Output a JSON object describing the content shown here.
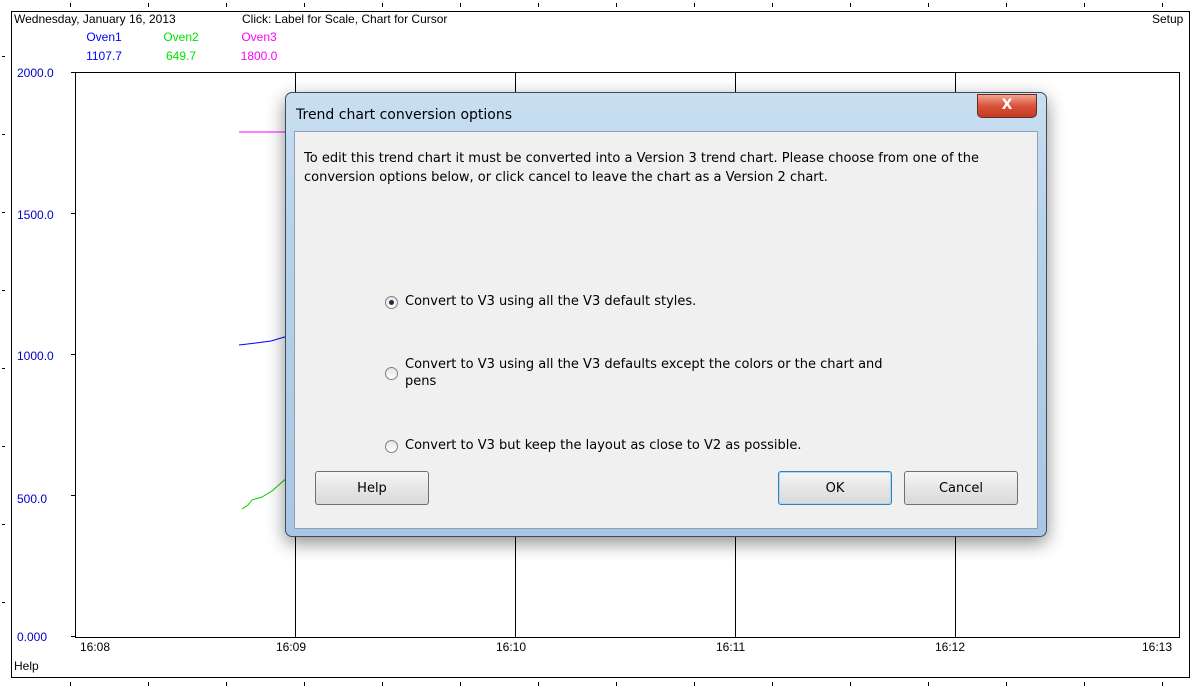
{
  "header": {
    "date": "Wednesday, January 16, 2013",
    "instruction": "Click: Label for Scale, Chart for Cursor",
    "setup_label": "Setup"
  },
  "pens": [
    {
      "name": "Oven1",
      "value": "1107.7",
      "color": "#0000ff"
    },
    {
      "name": "Oven2",
      "value": "649.7",
      "color": "#00e000"
    },
    {
      "name": "Oven3",
      "value": "1800.0",
      "color": "#ff00ff"
    }
  ],
  "y_axis": {
    "labels": [
      "2000.0",
      "1500.0",
      "1000.0",
      "500.0",
      "0.000"
    ]
  },
  "x_axis": {
    "labels": [
      "16:08",
      "16:09",
      "16:10",
      "16:11",
      "16:12",
      "16:13"
    ]
  },
  "status_bar": {
    "help_label": "Help"
  },
  "dialog": {
    "title": "Trend chart conversion options",
    "close_glyph": "X",
    "description": "To edit this trend chart it must be converted into a Version 3 trend chart. Please choose from one of the conversion options below, or click cancel to leave the chart as a Version 2 chart.",
    "options": [
      {
        "label": "Convert to V3 using all the V3 default styles.",
        "selected": true
      },
      {
        "label_line1": "Convert to V3 using all the V3 defaults except the colors or the chart and",
        "label_line2": "pens",
        "selected": false
      },
      {
        "label": "Convert to V3 but keep the layout as close to V2 as possible.",
        "selected": false
      }
    ],
    "help_button": "Help",
    "ok_button": "OK",
    "cancel_button": "Cancel"
  }
}
